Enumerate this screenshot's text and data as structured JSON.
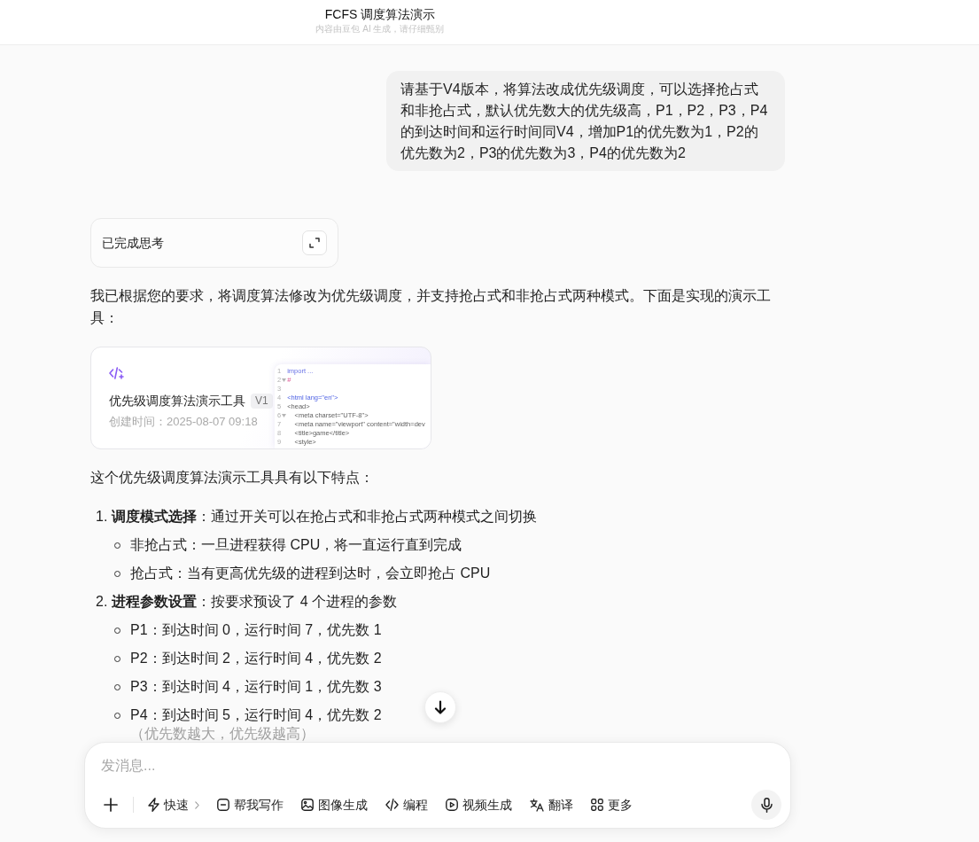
{
  "header": {
    "title": "FCFS 调度算法演示",
    "subtitle": "内容由豆包 AI 生成，请仔细甄别"
  },
  "user_message": {
    "text": "请基于V4版本，将算法改成优先级调度，可以选择抢占式和非抢占式，默认优先数大的优先级高，P1，P2，P3，P4的到达时间和运行时间同V4，增加P1的优先数为1，P2的优先数为2，P3的优先数为3，P4的优先数为2"
  },
  "thinking": {
    "label": "已完成思考"
  },
  "reply": {
    "intro": "我已根据您的要求，将调度算法修改为优先级调度，并支持抢占式和非抢占式两种模式。下面是实现的演示工具：",
    "artifact_card": {
      "title": "优先级调度算法演示工具",
      "version": "V1",
      "created": "创建时间：2025-08-07 09:18",
      "code_preview": [
        {
          "number": "1",
          "code": "import ...",
          "kind": "import",
          "foldable": false
        },
        {
          "number": "2",
          "code": "#",
          "kind": "symbol",
          "foldable": true
        },
        {
          "number": "3",
          "foldable": false
        },
        {
          "number": "4",
          "code": "<html lang=\"en\">",
          "kind": "html",
          "foldable": false
        },
        {
          "number": "5",
          "code": "<head>",
          "kind": "tag",
          "foldable": false
        },
        {
          "number": "6",
          "code": "    <meta charset=\"UTF-8\">",
          "kind": "tag",
          "foldable": true
        },
        {
          "number": "7",
          "code": "    <meta name=\"viewport\" content=\"width=dev",
          "kind": "tag",
          "foldable": false
        },
        {
          "number": "8",
          "code": "    <title>game</title>",
          "kind": "tag",
          "foldable": false
        },
        {
          "number": "9",
          "code": "    <style>",
          "kind": "tag",
          "foldable": false
        }
      ]
    },
    "summary": "这个优先级调度算法演示工具具有以下特点：",
    "features": [
      {
        "number": "1.",
        "text": "**调度模式选择**：通过开关可以在抢占式和非抢占式两种模式之间切换",
        "children": [
          {
            "text": "非抢占式：一旦进程获得 CPU，将一直运行直到完成"
          },
          {
            "text": "抢占式：当有更高优先级的进程到达时，会立即抢占 CPU"
          }
        ]
      },
      {
        "number": "2.",
        "text": "**进程参数设置**：按要求预设了 4 个进程的参数",
        "children": [
          {
            "text": "P1：到达时间 0，运行时间 7，优先数 1"
          },
          {
            "text": "P2：到达时间 2，运行时间 4，优先数 2"
          },
          {
            "text": "P3：到达时间 4，运行时间 1，优先数 3"
          },
          {
            "text": "P4：到达时间 5，运行时间 4，优先数 2",
            "note": "（优先数越大，优先级越高）"
          }
        ]
      }
    ]
  },
  "composer": {
    "placeholder": "发消息...",
    "tools": [
      {
        "kind": "speed",
        "label": "快速",
        "has_menu": true
      },
      {
        "kind": "write",
        "label": "帮我写作",
        "has_menu": false
      },
      {
        "kind": "image",
        "label": "图像生成",
        "has_menu": false
      },
      {
        "kind": "code",
        "label": "编程",
        "has_menu": false
      },
      {
        "kind": "video",
        "label": "视频生成",
        "has_menu": false
      },
      {
        "kind": "translate",
        "label": "翻译",
        "has_menu": false
      },
      {
        "kind": "more",
        "label": "更多",
        "has_menu": false
      }
    ]
  }
}
